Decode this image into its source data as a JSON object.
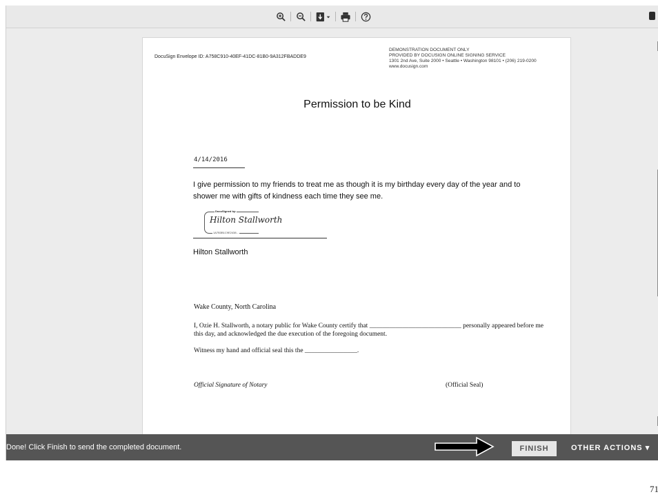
{
  "toolbar": {
    "icons": [
      "zoom-in-icon",
      "zoom-out-icon",
      "download-icon",
      "print-icon",
      "help-icon"
    ]
  },
  "document": {
    "envelope_id": "DocuSign Envelope ID: A758C910-40EF-41DC-81B0-9A312FBADDE9",
    "demo_header": [
      "DEMONSTRATION DOCUMENT ONLY",
      "PROVIDED BY DOCUSIGN ONLINE SIGNING SERVICE",
      "1301 2nd Ave, Suite 2000  • Seattle • Washington 98101 • (206) 219-0200",
      "www.docusign.com"
    ],
    "title": "Permission to be Kind",
    "date": "4/14/2016",
    "body": "I give permission to my friends to treat me as though it is my birthday every day of the year and to shower me with gifts of kindness each time they see me.",
    "signature": {
      "stamp_label": "DocuSigned by:",
      "signed_name": "Hilton Stallworth",
      "stamp_code": "1A7B3B1C9E2438..."
    },
    "signer_name": "Hilton Stallworth",
    "notary": {
      "county": "Wake County, North Carolina",
      "statement": "I, Ozie H. Stallworth, a notary public for Wake County certify that ____________________________ personally appeared before me this day, and acknowledged the due execution of the foregoing document.",
      "witness": "Witness my hand and official seal this the ________________.",
      "official_signature": "Official Signature of Notary",
      "official_seal": "(Official Seal)"
    }
  },
  "bottom_bar": {
    "message": "Done! Click Finish to send the completed document.",
    "finish_label": "FINISH",
    "other_actions_label": "OTHER ACTIONS ▾"
  },
  "page_number": "71"
}
